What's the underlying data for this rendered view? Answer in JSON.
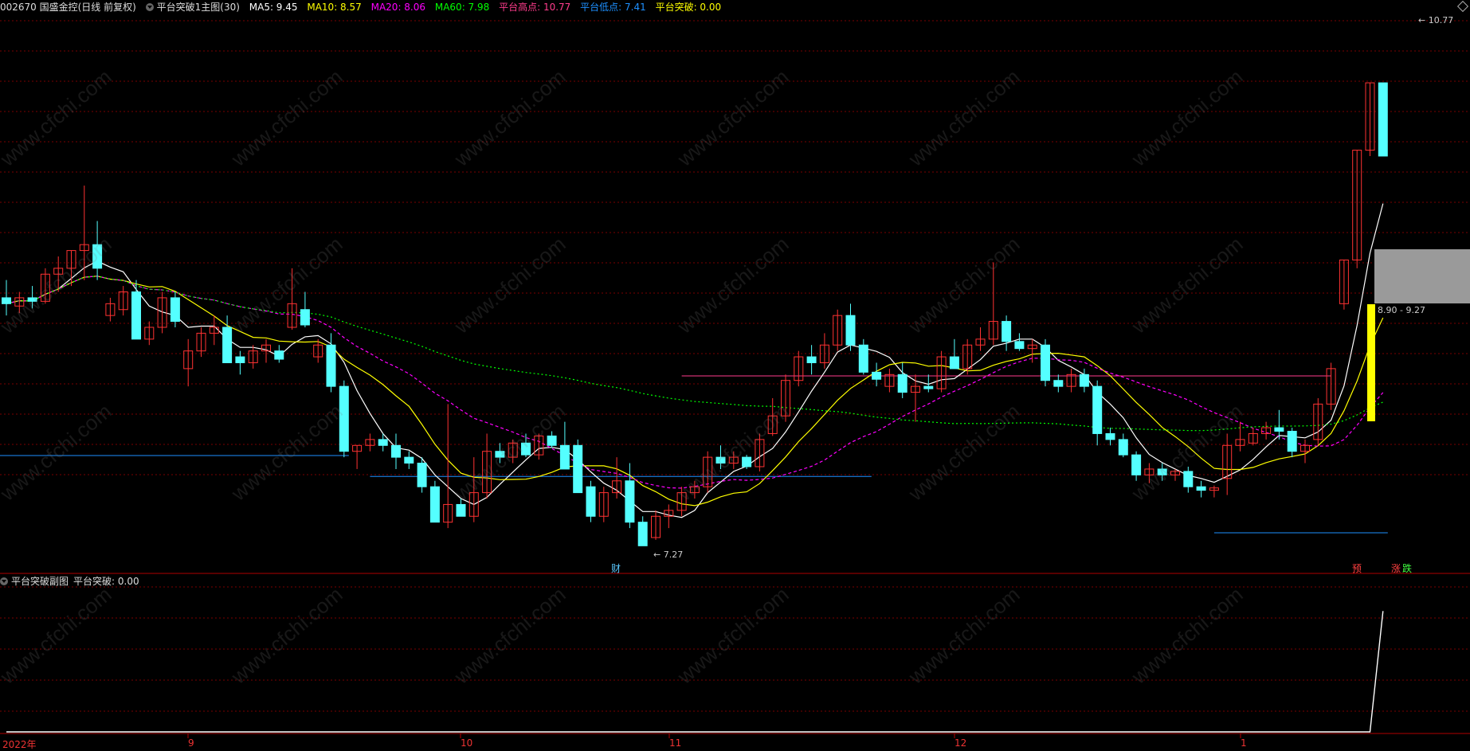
{
  "header": {
    "stock": "002670 国盛金控(日线 前复权)",
    "indicator": "平台突破1主图(30)",
    "ma5": "MA5: 9.45",
    "ma10": "MA10: 8.57",
    "ma20": "MA20: 8.06",
    "ma60": "MA60: 7.98",
    "platform_high": "平台高点: 10.77",
    "platform_low": "平台低点: 7.41",
    "platform_break": "平台突破: 0.00"
  },
  "sub_header": {
    "indicator": "平台突破副图",
    "platform_break": "平台突破: 0.00"
  },
  "annotations": {
    "high_label": "10.77",
    "low_label": "7.27",
    "range_label": "8.90 - 9.27",
    "cai_marker": "财",
    "yu_marker": "预",
    "zhang_marker": "涨",
    "die_marker": "跌"
  },
  "x_axis": [
    "2022年",
    "9",
    "10",
    "11",
    "12",
    "1"
  ],
  "watermark": "www.cfchi.com",
  "colors": {
    "background": "#000000",
    "up": "#ff3232",
    "down": "#54ffff",
    "ma5": "#ffffff",
    "ma10": "#ffff00",
    "ma20": "#ff00ff",
    "ma60": "#00ff00",
    "platform_high": "#ff3c8c",
    "platform_low": "#1e90ff",
    "signal": "#ffff00",
    "grid": "#7a0000"
  },
  "chart_data": {
    "type": "candlestick",
    "candles": [
      [
        8.95,
        9.1,
        8.8,
        8.9
      ],
      [
        8.88,
        9.0,
        8.82,
        8.95
      ],
      [
        8.95,
        9.05,
        8.86,
        8.92
      ],
      [
        8.92,
        9.2,
        8.9,
        9.15
      ],
      [
        9.15,
        9.3,
        9.0,
        9.2
      ],
      [
        9.2,
        9.35,
        9.05,
        9.35
      ],
      [
        9.35,
        9.9,
        9.1,
        9.4
      ],
      [
        9.4,
        9.6,
        9.1,
        9.2
      ],
      [
        8.8,
        8.95,
        8.75,
        8.9
      ],
      [
        8.85,
        9.05,
        8.8,
        9.0
      ],
      [
        9.0,
        9.1,
        8.7,
        8.6
      ],
      [
        8.6,
        8.75,
        8.55,
        8.7
      ],
      [
        8.7,
        9.0,
        8.65,
        8.95
      ],
      [
        8.95,
        9.0,
        8.7,
        8.75
      ],
      [
        8.35,
        8.6,
        8.2,
        8.5
      ],
      [
        8.5,
        8.7,
        8.45,
        8.65
      ],
      [
        8.65,
        8.8,
        8.55,
        8.7
      ],
      [
        8.7,
        8.8,
        8.45,
        8.4
      ],
      [
        8.45,
        8.5,
        8.3,
        8.4
      ],
      [
        8.4,
        8.55,
        8.35,
        8.5
      ],
      [
        8.5,
        8.6,
        8.4,
        8.55
      ],
      [
        8.5,
        8.55,
        8.4,
        8.43
      ],
      [
        8.7,
        9.2,
        8.68,
        8.9
      ],
      [
        8.85,
        9.0,
        8.7,
        8.72
      ],
      [
        8.45,
        8.6,
        8.4,
        8.55
      ],
      [
        8.55,
        8.65,
        8.15,
        8.2
      ],
      [
        8.2,
        8.25,
        7.6,
        7.65
      ],
      [
        7.65,
        7.7,
        7.5,
        7.7
      ],
      [
        7.7,
        7.8,
        7.65,
        7.75
      ],
      [
        7.75,
        7.8,
        7.65,
        7.7
      ],
      [
        7.7,
        7.8,
        7.5,
        7.6
      ],
      [
        7.6,
        7.65,
        7.5,
        7.55
      ],
      [
        7.55,
        7.6,
        7.3,
        7.35
      ],
      [
        7.35,
        7.4,
        7.18,
        7.05
      ],
      [
        7.05,
        8.05,
        7.0,
        7.2
      ],
      [
        7.2,
        7.25,
        7.12,
        7.1
      ],
      [
        7.1,
        7.6,
        7.05,
        7.3
      ],
      [
        7.3,
        7.8,
        7.25,
        7.65
      ],
      [
        7.65,
        7.72,
        7.55,
        7.6
      ],
      [
        7.6,
        7.75,
        7.55,
        7.72
      ],
      [
        7.72,
        7.8,
        7.6,
        7.62
      ],
      [
        7.62,
        7.8,
        7.58,
        7.78
      ],
      [
        7.78,
        7.82,
        7.68,
        7.7
      ],
      [
        7.7,
        7.9,
        7.6,
        7.5
      ],
      [
        7.7,
        7.75,
        7.35,
        7.3
      ],
      [
        7.35,
        7.4,
        7.05,
        7.1
      ],
      [
        7.1,
        7.35,
        7.05,
        7.3
      ],
      [
        7.3,
        7.6,
        7.25,
        7.4
      ],
      [
        7.4,
        7.55,
        7.0,
        7.05
      ],
      [
        7.05,
        7.1,
        6.88,
        6.85
      ],
      [
        6.92,
        7.15,
        6.9,
        7.1
      ],
      [
        7.1,
        7.2,
        7.0,
        7.15
      ],
      [
        7.15,
        7.35,
        7.1,
        7.3
      ],
      [
        7.3,
        7.4,
        7.25,
        7.35
      ],
      [
        7.35,
        7.65,
        7.3,
        7.6
      ],
      [
        7.6,
        7.7,
        7.5,
        7.55
      ],
      [
        7.55,
        7.65,
        7.5,
        7.6
      ],
      [
        7.6,
        7.62,
        7.5,
        7.52
      ],
      [
        7.52,
        7.8,
        7.48,
        7.75
      ],
      [
        7.8,
        8.1,
        7.78,
        7.95
      ],
      [
        7.95,
        8.3,
        7.9,
        8.25
      ],
      [
        8.25,
        8.5,
        8.2,
        8.45
      ],
      [
        8.45,
        8.55,
        8.3,
        8.4
      ],
      [
        8.4,
        8.65,
        8.35,
        8.55
      ],
      [
        8.55,
        8.85,
        8.5,
        8.8
      ],
      [
        8.8,
        8.9,
        8.5,
        8.55
      ],
      [
        8.55,
        8.6,
        8.3,
        8.32
      ],
      [
        8.32,
        8.4,
        8.2,
        8.26
      ],
      [
        8.2,
        8.35,
        8.15,
        8.3
      ],
      [
        8.3,
        8.4,
        8.1,
        8.15
      ],
      [
        8.15,
        8.3,
        7.9,
        8.2
      ],
      [
        8.2,
        8.3,
        8.15,
        8.18
      ],
      [
        8.18,
        8.5,
        8.15,
        8.45
      ],
      [
        8.45,
        8.6,
        8.4,
        8.35
      ],
      [
        8.35,
        8.6,
        8.3,
        8.55
      ],
      [
        8.55,
        8.7,
        8.5,
        8.6
      ],
      [
        8.6,
        9.25,
        8.55,
        8.75
      ],
      [
        8.75,
        8.8,
        8.5,
        8.58
      ],
      [
        8.58,
        8.65,
        8.5,
        8.52
      ],
      [
        8.52,
        8.6,
        8.4,
        8.55
      ],
      [
        8.55,
        8.6,
        8.2,
        8.25
      ],
      [
        8.25,
        8.3,
        8.15,
        8.2
      ],
      [
        8.2,
        8.35,
        8.15,
        8.3
      ],
      [
        8.3,
        8.35,
        8.15,
        8.2
      ],
      [
        8.2,
        8.25,
        7.7,
        7.8
      ],
      [
        7.8,
        7.85,
        7.7,
        7.75
      ],
      [
        7.75,
        7.8,
        7.6,
        7.62
      ],
      [
        7.62,
        7.65,
        7.4,
        7.45
      ],
      [
        7.45,
        7.55,
        7.38,
        7.5
      ],
      [
        7.5,
        7.55,
        7.4,
        7.45
      ],
      [
        7.45,
        7.5,
        7.4,
        7.48
      ],
      [
        7.48,
        7.52,
        7.3,
        7.35
      ],
      [
        7.35,
        7.4,
        7.26,
        7.32
      ],
      [
        7.32,
        7.36,
        7.26,
        7.34
      ],
      [
        7.42,
        7.8,
        7.28,
        7.7
      ],
      [
        7.7,
        7.9,
        7.65,
        7.75
      ],
      [
        7.72,
        7.85,
        7.7,
        7.8
      ],
      [
        7.8,
        7.9,
        7.75,
        7.85
      ],
      [
        7.85,
        8.0,
        7.75,
        7.82
      ],
      [
        7.82,
        7.85,
        7.6,
        7.65
      ],
      [
        7.65,
        7.75,
        7.55,
        7.7
      ],
      [
        7.75,
        8.1,
        7.7,
        8.05
      ],
      [
        8.05,
        8.4,
        8.0,
        8.35
      ],
      [
        8.9,
        9.27,
        8.85,
        9.27
      ],
      [
        9.27,
        10.2,
        9.2,
        10.2
      ],
      [
        10.2,
        10.77,
        10.15,
        10.77
      ],
      [
        10.77,
        10.77,
        10.15,
        10.15
      ]
    ],
    "platform_high": 10.77,
    "platform_low": 7.41,
    "ylim": [
      6.65,
      11.35
    ],
    "sub": {
      "type": "line",
      "ylim": [
        0,
        1.2
      ],
      "spike_index": 106
    }
  }
}
